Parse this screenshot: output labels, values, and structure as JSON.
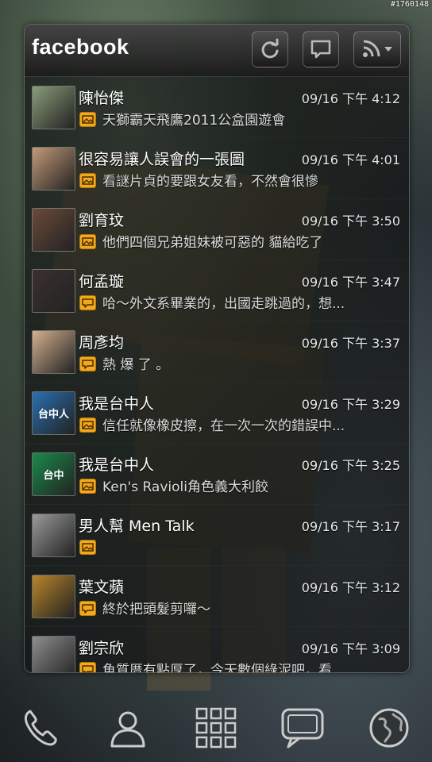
{
  "corner_tag": "#1760148",
  "widget": {
    "brand": "facebook",
    "buttons": [
      {
        "name": "refresh",
        "icon": "refresh-icon"
      },
      {
        "name": "compose",
        "icon": "speech-bubble-icon"
      },
      {
        "name": "feed-menu",
        "icon": "rss-dropdown-icon"
      }
    ]
  },
  "feed": [
    {
      "name": "陳怡傑",
      "time": "09/16 下午 4:12",
      "type": "photo",
      "message": "天獅霸天飛鷹2011公盒園遊會",
      "avatar_color": "#8a9c7a"
    },
    {
      "name": "很容易讓人誤會的一張圖",
      "time": "09/16 下午 4:01",
      "type": "photo",
      "message": "看謎片貞的要跟女友看，不然會很慘",
      "avatar_color": "#c49a78"
    },
    {
      "name": "劉育玟",
      "time": "09/16 下午 3:50",
      "type": "photo",
      "message": "他們四個兄弟姐妹被可惡的 貓給吃了",
      "avatar_color": "#6b4a3a"
    },
    {
      "name": "何孟璇",
      "time": "09/16 下午 3:47",
      "type": "status",
      "message": "哈～外文系畢業的，出國走跳過的，想...",
      "avatar_color": "#3c3030"
    },
    {
      "name": "周彥均",
      "time": "09/16 下午 3:37",
      "type": "status",
      "message": "熱 爆 了 。",
      "avatar_color": "#d4b08e"
    },
    {
      "name": "我是台中人",
      "time": "09/16 下午 3:29",
      "type": "photo",
      "message": "信任就像橡皮擦，在一次一次的錯誤中...",
      "avatar_color": "#2a6fb0",
      "avatar_text": "台中人"
    },
    {
      "name": "我是台中人",
      "time": "09/16 下午 3:25",
      "type": "photo",
      "message": "Ken's Ravioli角色義大利餃",
      "avatar_color": "#1a8a4a",
      "avatar_text": "台中"
    },
    {
      "name": "男人幫 Men Talk",
      "time": "09/16 下午 3:17",
      "type": "photo",
      "message": "",
      "avatar_color": "#9a9a9a"
    },
    {
      "name": "葉文蘋",
      "time": "09/16 下午 3:12",
      "type": "status",
      "message": "終於把頭髮剪囉～",
      "avatar_color": "#b8852a"
    },
    {
      "name": "劉宗欣",
      "time": "09/16 下午 3:09",
      "type": "status",
      "message": "魚質厝有點厚了，今天數個綠泥吧，看",
      "avatar_color": "#8e8e8e"
    }
  ],
  "dock": [
    {
      "name": "phone",
      "icon": "phone-icon"
    },
    {
      "name": "contacts",
      "icon": "person-icon"
    },
    {
      "name": "app-drawer",
      "icon": "grid-icon"
    },
    {
      "name": "messaging",
      "icon": "chat-icon"
    },
    {
      "name": "browser",
      "icon": "globe-icon"
    }
  ]
}
